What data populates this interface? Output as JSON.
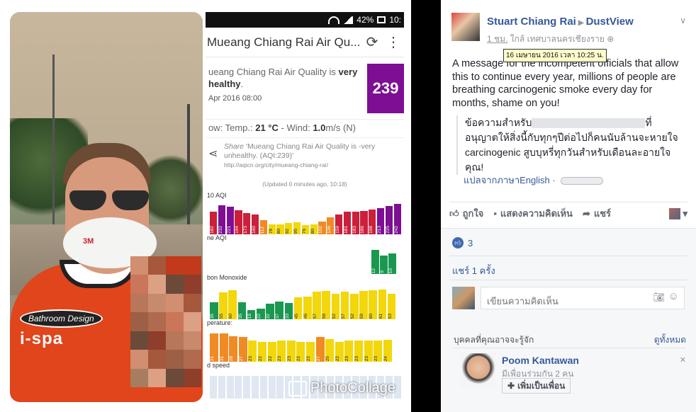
{
  "collage": {
    "photo_logo_top": "Bathroom Design",
    "photo_logo_bottom": "i-spa",
    "watermark": "PhotoCollage"
  },
  "phone": {
    "status": {
      "battery": "42%",
      "clock": "10:"
    },
    "app_title": "Mueang Chiang Rai Air Qu...",
    "headline_prefix": "ueang Chiang Rai Air Quality is ",
    "headline_level": "very",
    "headline_level2": "healthy",
    "date": "Apr 2016 08:00",
    "aqi_value": "239",
    "aqi_color": "#7e0e94",
    "weather_prefix": "ow: Temp.: ",
    "temp": "21 °C",
    "wind_prefix": " - Wind: ",
    "wind": "1.0",
    "wind_suffix": "m/s (N)",
    "share_label": "Share",
    "share_text": " 'Mueang Chiang Rai Air Quality is -very unhealthy. (AQI:239)'",
    "share_url": "http://aqicn.org/city/mueang-chiang-rai/",
    "updated": "(Updated 0 minutes ago, 10:18)",
    "sections": [
      {
        "label": "10 AQI",
        "values": [
          "182",
          "232",
          "221",
          "194",
          "173",
          "160",
          "112",
          "78",
          "80",
          "92",
          "95",
          "76",
          "80",
          "102",
          "136",
          "159",
          "181",
          "183",
          "186",
          "198",
          "213",
          "225",
          "242"
        ]
      },
      {
        "label": "ne AQI",
        "values": [
          "12",
          "9",
          "10"
        ]
      },
      {
        "label": "bon Monoxide",
        "values": [
          "35",
          "55",
          "60",
          "35",
          "19",
          "22",
          "32",
          "37",
          "33",
          "45",
          "46",
          "57",
          "59",
          "52",
          "57",
          "52",
          "59",
          "60",
          "61",
          "53"
        ]
      },
      {
        "label": "perature:",
        "values": [
          "31",
          "31",
          "28",
          "27",
          "23",
          "22",
          "22",
          "23",
          "23",
          "22",
          "22",
          "27",
          "25",
          "22",
          "23",
          "23",
          "23",
          "23",
          "24"
        ]
      },
      {
        "label": "d speed",
        "values": []
      }
    ]
  },
  "post": {
    "author": "Stuart Chiang Rai",
    "page": "DustView",
    "time": "1 ชม.",
    "location": "ใกล้ เทศบาลนครเชียงราย",
    "tooltip": "16 เมษายน 2016 เวลา 10:25 น.",
    "text": "A message for the incompetent officials that allow this to continue every year, millions of people are breathing carcinogenic smoke every day for months, shame on you!",
    "translation_start": "ข้อความสำหรับ",
    "translation_end": "ที่ อนุญาตให้สิ่งนี้กับทุกๆปีต่อไปก็คนนับล้านจะหายใจ carcinogenic สูบบุหรี่ทุกวันสำหรับเดือนละอายใจคุณ!",
    "translate_link": "แปลจากภาษาEnglish",
    "actions": {
      "like": "ถูกใจ",
      "comment": "แสดงความคิดเห็น",
      "share": "แชร์"
    },
    "likes_count": "3",
    "shares": "แชร์ 1 ครั้ง",
    "comment_placeholder": "เขียนความคิดเห็น",
    "pymk_title": "บุคคลที่คุณอาจจะรู้จัก",
    "pymk_see_all": "ดูทั้งหมด",
    "person_name": "Poom Kantawan",
    "person_mutual": "มีเพื่อนร่วมกัน 2 คน",
    "add_friend": "เพิ่มเป็นเพื่อน"
  }
}
